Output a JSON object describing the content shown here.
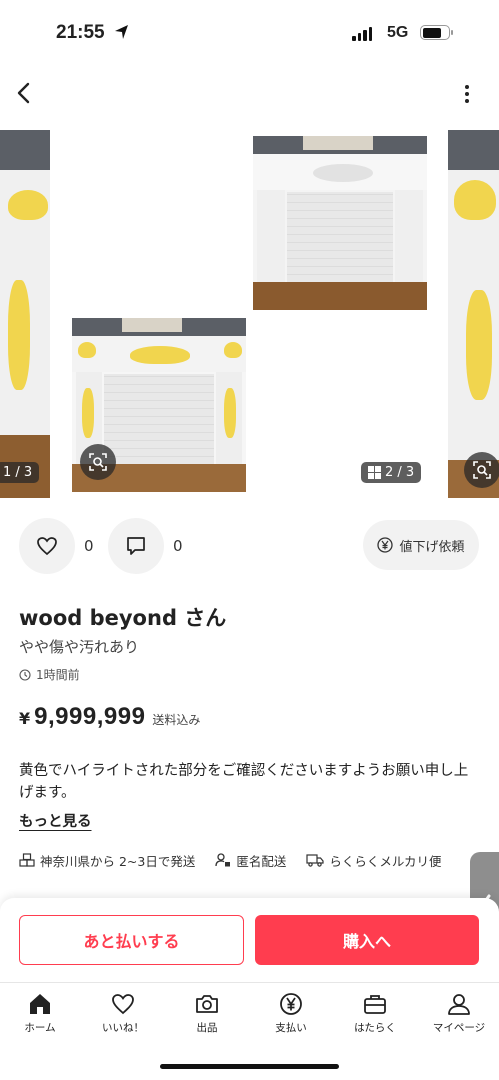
{
  "status": {
    "time": "21:55",
    "network": "5G"
  },
  "gallery": {
    "counter_left": "1 / 3",
    "counter_right": "2 / 3"
  },
  "actions": {
    "likes": "0",
    "comments": "0",
    "price_request": "値下げ依頼"
  },
  "item": {
    "seller": "wood beyond さん",
    "condition": "やや傷や汚れあり",
    "posted": "1時間前",
    "currency": "¥",
    "price": "9,999,999",
    "shipping_note": "送料込み",
    "description": "黄色でハイライトされた部分をご確認くださいますようお願い申し上げます。",
    "more": "もっと見る"
  },
  "shipping": {
    "origin": "神奈川県から 2~3日で発送",
    "anonymous": "匿名配送",
    "method": "らくらくメルカリ便"
  },
  "buttons": {
    "pay_later": "あと払いする",
    "buy": "購入へ"
  },
  "tabs": [
    {
      "label": "ホーム",
      "icon": "home-icon"
    },
    {
      "label": "いいね！",
      "icon": "heart-icon"
    },
    {
      "label": "出品",
      "icon": "camera-icon"
    },
    {
      "label": "支払い",
      "icon": "yen-icon"
    },
    {
      "label": "はたらく",
      "icon": "briefcase-icon"
    },
    {
      "label": "マイページ",
      "icon": "person-icon"
    }
  ],
  "colors": {
    "accent": "#ff3d4f",
    "highlight": "#f1d23c"
  }
}
